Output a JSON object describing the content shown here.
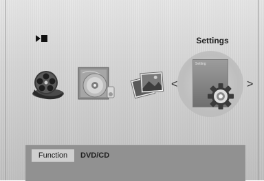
{
  "menu": {
    "selected_label": "Settings",
    "left_arrow": "<",
    "right_arrow": ">",
    "items": [
      {
        "name": "film-reel",
        "icon": "film-reel-icon"
      },
      {
        "name": "music-disc",
        "icon": "disc-icon"
      },
      {
        "name": "photos",
        "icon": "photo-stack-icon"
      },
      {
        "name": "settings",
        "icon": "gear-icon"
      }
    ]
  },
  "settings_card": {
    "title": "Setting"
  },
  "info_bar": {
    "function_label": "Function",
    "function_value": "DVD/CD"
  },
  "status": {
    "playback_icon": "play-stop-icon"
  }
}
